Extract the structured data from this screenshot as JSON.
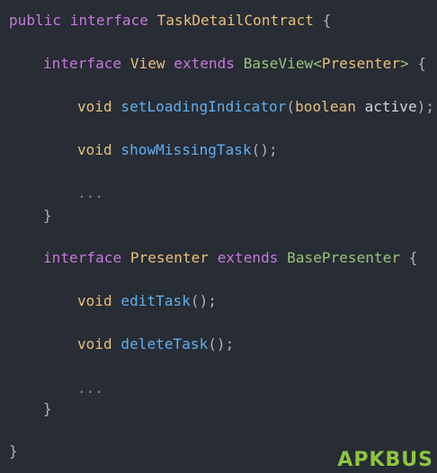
{
  "watermark": "APKBUS",
  "code": {
    "l1": {
      "kw1": "public",
      "kw2": "interface",
      "name": "TaskDetailContract",
      "brace": "{"
    },
    "l2": {
      "kw1": "interface",
      "name": "View",
      "kw2": "extends",
      "base": "BaseView",
      "lt": "<",
      "generic": "Presenter",
      "gt": ">",
      "brace": "{"
    },
    "l3": {
      "ret": "void",
      "fn": "setLoadingIndicator",
      "open": "(",
      "ptype": "boolean",
      "pname": "active",
      "close": ");"
    },
    "l4": {
      "ret": "void",
      "fn": "showMissingTask",
      "rest": "();"
    },
    "l5": {
      "ellipsis": "..."
    },
    "l6": {
      "brace": "}"
    },
    "l7": {
      "kw1": "interface",
      "name": "Presenter",
      "kw2": "extends",
      "base": "BasePresenter",
      "brace": "{"
    },
    "l8": {
      "ret": "void",
      "fn": "editTask",
      "rest": "();"
    },
    "l9": {
      "ret": "void",
      "fn": "deleteTask",
      "rest": "();"
    },
    "l10": {
      "ellipsis": "..."
    },
    "l11": {
      "brace": "}"
    },
    "l12": {
      "brace": "}"
    }
  }
}
